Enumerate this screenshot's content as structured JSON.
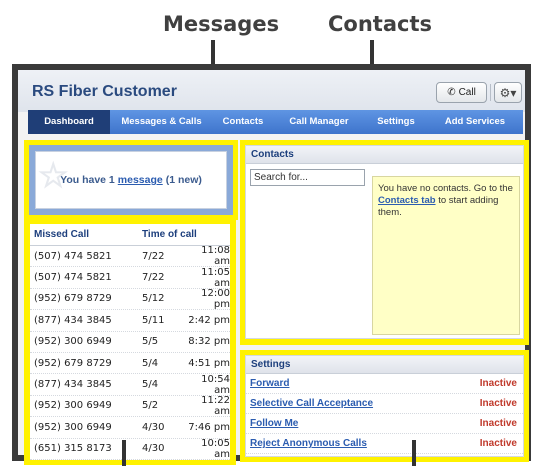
{
  "callouts": {
    "messages": "Messages",
    "contacts": "Contacts"
  },
  "app": {
    "title": "RS Fiber Customer",
    "call_label": "Call",
    "gear_icon": "gear-icon"
  },
  "nav": [
    {
      "label": "Dashboard"
    },
    {
      "label": "Messages & Calls"
    },
    {
      "label": "Contacts"
    },
    {
      "label": "Call Manager"
    },
    {
      "label": "Settings"
    },
    {
      "label": "Add Services"
    }
  ],
  "messages": {
    "prefix": "You have 1",
    "link": "message",
    "suffix": "(1 new)"
  },
  "missed_calls": {
    "header_number": "Missed Call",
    "header_time": "Time of call",
    "rows": [
      {
        "number": "(507) 474 5821",
        "date": "7/22",
        "time": "11:08 am"
      },
      {
        "number": "(507) 474 5821",
        "date": "7/22",
        "time": "11:05 am"
      },
      {
        "number": "(952) 679 8729",
        "date": "5/12",
        "time": "12:00 pm"
      },
      {
        "number": "(877) 434 3845",
        "date": "5/11",
        "time": "2:42 pm"
      },
      {
        "number": "(952) 300 6949",
        "date": "5/5",
        "time": "8:32 pm"
      },
      {
        "number": "(952) 679 8729",
        "date": "5/4",
        "time": "4:51 pm"
      },
      {
        "number": "(877) 434 3845",
        "date": "5/4",
        "time": "10:54 am"
      },
      {
        "number": "(952) 300 6949",
        "date": "5/2",
        "time": "11:22 am"
      },
      {
        "number": "(952) 300 6949",
        "date": "4/30",
        "time": "7:46 pm"
      },
      {
        "number": "(651) 315 8173",
        "date": "4/30",
        "time": "10:05 am"
      }
    ]
  },
  "contacts": {
    "title": "Contacts",
    "search_placeholder": "Search for...",
    "note_before": "You have no contacts. Go to the",
    "note_link": "Contacts tab",
    "note_after": "to start adding them."
  },
  "settings": {
    "title": "Settings",
    "rows": [
      {
        "label": "Forward",
        "status": "Inactive"
      },
      {
        "label": "Selective Call Acceptance",
        "status": "Inactive"
      },
      {
        "label": "Follow Me",
        "status": "Inactive"
      },
      {
        "label": "Reject Anonymous Calls",
        "status": "Inactive"
      }
    ]
  },
  "colors": {
    "highlight": "#fff200",
    "nav": "#3e74cc",
    "nav_active": "#1f3e77",
    "status": "#c0392b"
  }
}
